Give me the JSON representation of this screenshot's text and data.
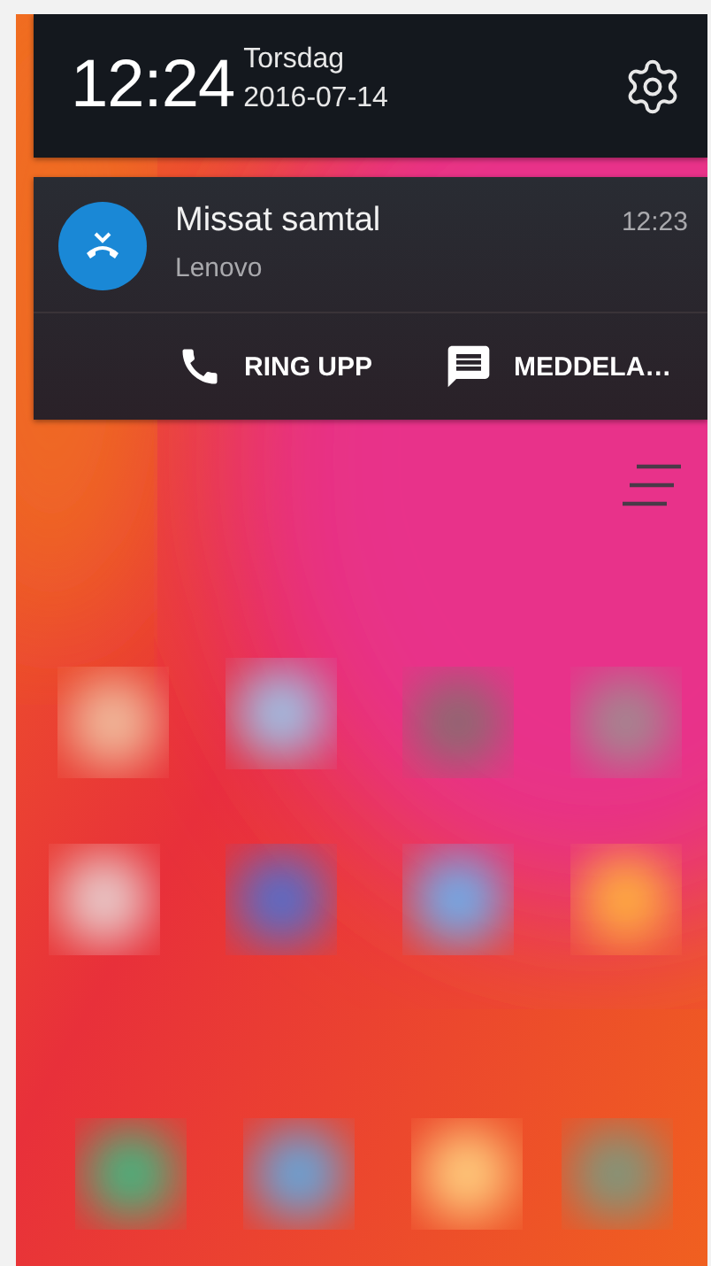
{
  "clock": {
    "time": "12:24",
    "weekday": "Torsdag",
    "date": "2016-07-14"
  },
  "notification": {
    "title": "Missat samtal",
    "time": "12:23",
    "subtitle": "Lenovo",
    "actions": [
      {
        "kind": "call",
        "label": "RING UPP"
      },
      {
        "kind": "message",
        "label": "MEDDELA…"
      }
    ]
  }
}
